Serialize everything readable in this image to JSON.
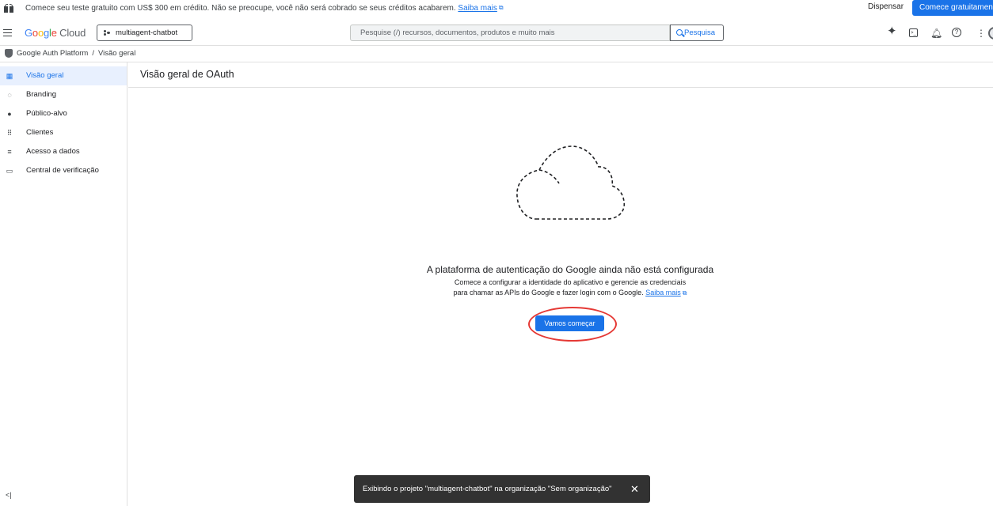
{
  "promo": {
    "text": "Comece seu teste gratuito com US$ 300 em crédito. Não se preocupe, você não será cobrado se seus créditos acabarem.",
    "link": "Saiba mais",
    "dismiss": "Dispensar",
    "cta": "Comece gratuitamente"
  },
  "header": {
    "logo_google": "Google",
    "logo_cloud": "Cloud",
    "project": "multiagent-chatbot",
    "search_placeholder": "Pesquise (/) recursos, documentos, produtos e muito mais",
    "search_button": "Pesquisa",
    "icons": [
      "gemini-icon",
      "terminal-icon",
      "notifications-icon",
      "help-icon",
      "more-vert-icon",
      "avatar"
    ]
  },
  "breadcrumb": {
    "root": "Google Auth Platform",
    "current": "Visão geral"
  },
  "sidebar": {
    "items": [
      {
        "label": "Visão geral",
        "icon": "dashboard-icon",
        "active": true
      },
      {
        "label": "Branding",
        "icon": "palette-icon",
        "active": false
      },
      {
        "label": "Público-alvo",
        "icon": "account-icon",
        "active": false
      },
      {
        "label": "Clientes",
        "icon": "grid-icon",
        "active": false
      },
      {
        "label": "Acesso a dados",
        "icon": "data-access-icon",
        "active": false
      },
      {
        "label": "Central de verificação",
        "icon": "verification-icon",
        "active": false
      }
    ]
  },
  "main": {
    "title": "Visão geral de OAuth",
    "empty_title": "A plataforma de autenticação do Google ainda não está configurada",
    "empty_line1": "Comece a configurar a identidade do aplicativo e gerencie as credenciais",
    "empty_line2": "para chamar as APIs do Google e fazer login com o Google.",
    "empty_link": "Saiba mais",
    "start_button": "Vamos começar"
  },
  "snackbar": {
    "message": "Exibindo o projeto \"multiagent-chatbot\" na organização \"Sem organização\"",
    "close": "✕"
  },
  "colors": {
    "primary": "#1a73e8",
    "active_bg": "#e8f0fe",
    "highlight_ring": "#e53935",
    "snackbar_bg": "#323232"
  }
}
